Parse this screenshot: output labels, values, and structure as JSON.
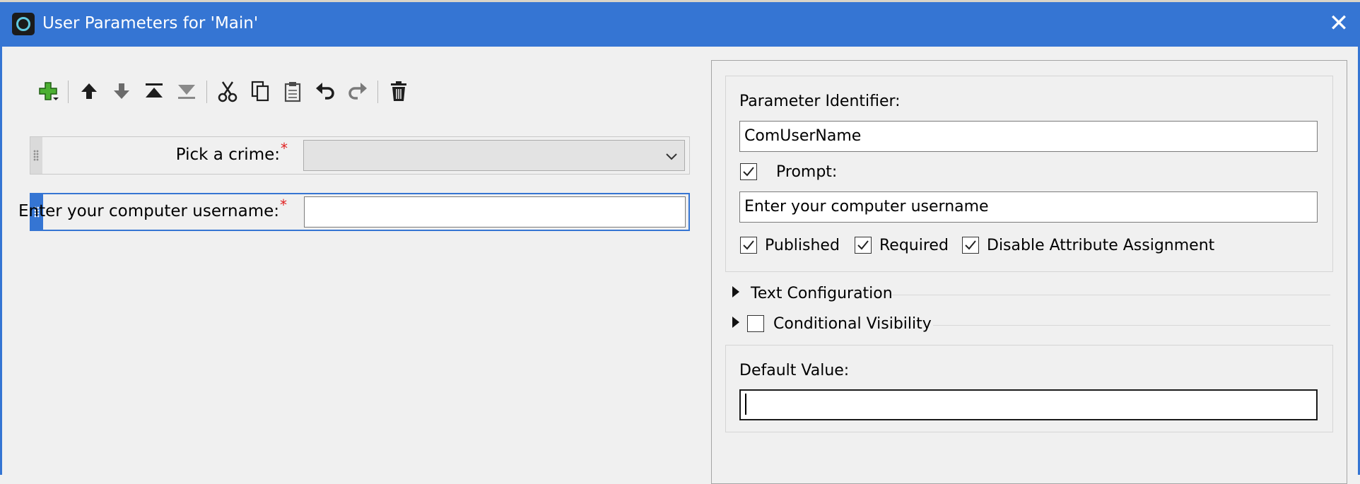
{
  "window": {
    "title": "User Parameters for 'Main'",
    "close_glyph": "✕",
    "accent": "#3575d3"
  },
  "toolbar": {
    "icons": [
      "add-parameter-icon",
      "move-up-icon",
      "move-down-icon",
      "move-to-top-icon",
      "move-to-bottom-icon",
      "cut-icon",
      "copy-icon",
      "paste-icon",
      "undo-icon",
      "redo-icon",
      "delete-icon"
    ]
  },
  "parameters": [
    {
      "label": "Pick a crime:",
      "required_marker": "*",
      "control": "dropdown",
      "value": ""
    },
    {
      "label": "Enter your computer username:",
      "required_marker": "*",
      "control": "text",
      "value": ""
    }
  ],
  "details": {
    "identifier_label": "Parameter Identifier:",
    "identifier_value": "ComUserName",
    "prompt_label": "Prompt:",
    "prompt_checked": true,
    "prompt_value": "Enter your computer username",
    "published_label": "Published",
    "published_checked": true,
    "required_label": "Required",
    "required_checked": true,
    "disable_attr_label": "Disable Attribute Assignment",
    "disable_attr_checked": true,
    "text_config_label": "Text Configuration",
    "cond_vis_label": "Conditional Visibility",
    "cond_vis_checked": false,
    "default_value_label": "Default Value:",
    "default_value": ""
  }
}
